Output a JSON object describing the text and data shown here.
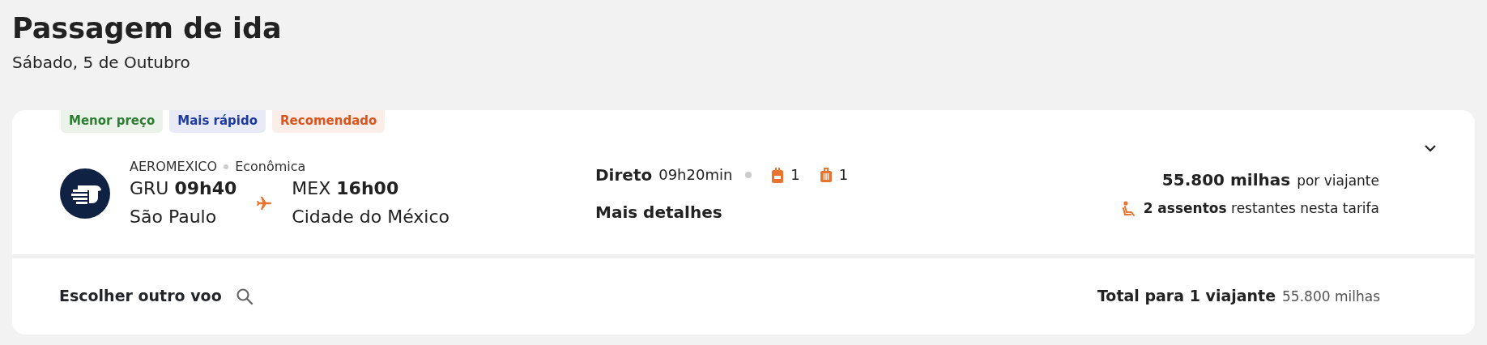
{
  "header": {
    "title": "Passagem de ida",
    "subtitle": "Sábado, 5 de Outubro"
  },
  "flight": {
    "tags": [
      {
        "label": "Menor preço",
        "color": "#2e7d32"
      },
      {
        "label": "Mais rápido",
        "color": "#1e3a9e"
      },
      {
        "label": "Recomendado",
        "color": "#d9541e"
      }
    ],
    "airline": "AEROMEXICO",
    "cabin": "Econômica",
    "departure": {
      "code": "GRU",
      "time": "09h40",
      "city": "São Paulo"
    },
    "arrival": {
      "code": "MEX",
      "time": "16h00",
      "city": "Cidade do México"
    },
    "stops": "Direto",
    "duration": "09h20min",
    "backpack_count": "1",
    "suitcase_count": "1",
    "details_link": "Mais detalhes",
    "price": "55.800 milhas",
    "price_note": "por viajante",
    "seats": "**2 assentos** restantes nesta tarifa",
    "expanded": false
  },
  "footer": {
    "change_flight": "Escolher outro voo",
    "total_label": "Total para 1 viajante",
    "total_value": "55.800 milhas"
  }
}
